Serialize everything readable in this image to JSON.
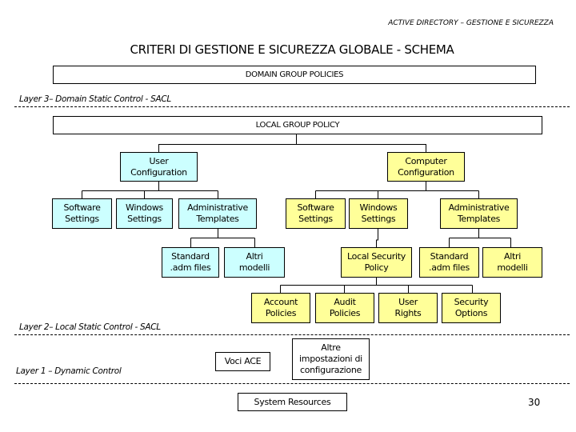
{
  "header": {
    "note": "ACTIVE DIRECTORY – GESTIONE E SICUREZZA",
    "title": "CRITERI DI GESTIONE E SICUREZZA GLOBALE - SCHEMA"
  },
  "boxes": {
    "domain_group_policies": "DOMAIN GROUP POLICIES",
    "local_group_policy": "LOCAL GROUP POLICY",
    "user_configuration": [
      "User",
      "Configuration"
    ],
    "computer_configuration": [
      "Computer",
      "Configuration"
    ],
    "user_children": {
      "software_settings": [
        "Software",
        "Settings"
      ],
      "windows_settings": [
        "Windows",
        "Settings"
      ],
      "administrative_templates": [
        "Administrative",
        "Templates"
      ],
      "standard_adm": [
        "Standard",
        ".adm files"
      ],
      "altri_modelli": [
        "Altri",
        "modelli"
      ]
    },
    "computer_children": {
      "software_settings": [
        "Software",
        "Settings"
      ],
      "windows_settings": [
        "Windows",
        "Settings"
      ],
      "administrative_templates": [
        "Administrative",
        "Templates"
      ],
      "local_security_policy": [
        "Local Security",
        "Policy"
      ],
      "standard_adm": [
        "Standard",
        ".adm files"
      ],
      "altri_modelli": [
        "Altri",
        "modelli"
      ],
      "account_policies": [
        "Account",
        "Policies"
      ],
      "audit_policies": [
        "Audit",
        "Policies"
      ],
      "user_rights": [
        "User",
        "Rights"
      ],
      "security_options": [
        "Security",
        "Options"
      ]
    },
    "voci_ace": "Voci ACE",
    "altre_impostazioni": [
      "Altre",
      "impostazioni di",
      "configurazione"
    ],
    "system_resources": "System Resources"
  },
  "layers": {
    "layer3": "Layer 3– Domain Static Control - SACL",
    "layer2": "Layer 2– Local Static Control - SACL",
    "layer1": "Layer 1 – Dynamic Control"
  },
  "colors": {
    "user_branch": "#ccffff",
    "computer_branch": "#ffff99"
  },
  "page_number": "30"
}
